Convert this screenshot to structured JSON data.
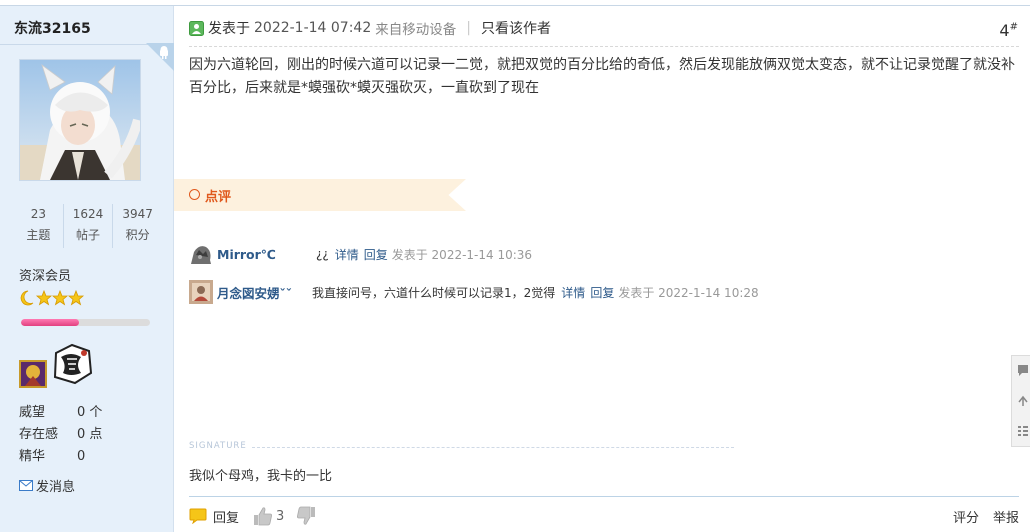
{
  "sidebar": {
    "username": "东流32165",
    "stats": [
      {
        "value": "23",
        "label": "主题"
      },
      {
        "value": "1624",
        "label": "帖子"
      },
      {
        "value": "3947",
        "label": "积分"
      }
    ],
    "group": "资深会员",
    "level_progress_percent": 45,
    "info": [
      {
        "key": "威望",
        "value": "0 个"
      },
      {
        "key": "存在感",
        "value": "0 点"
      },
      {
        "key": "精华",
        "value": "0"
      }
    ],
    "message_label": "发消息"
  },
  "post": {
    "header_label": "发表于",
    "time": "2022-1-14 07:42",
    "source": "来自移动设备",
    "only_author": "只看该作者",
    "floor": "4",
    "floor_suffix": "#",
    "content": "因为六道轮回，刚出的时候六道可以记录一二觉，就把双觉的百分比给的奇低，然后发现能放俩双觉太变态，就不让记录觉醒了就没补百分比，后来就是*蟆强砍*蟆灭强砍灭，一直砍到了现在"
  },
  "comments": {
    "title": "点评",
    "items": [
      {
        "user": "Mirror℃",
        "text": "¿¿",
        "detail": "详情",
        "reply": "回复",
        "date": "发表于 2022-1-14 10:36"
      },
      {
        "user": "月念図安娚ˇˇ",
        "text": "我直接问号，六道什么时候可以记录1，2觉得",
        "detail": "详情",
        "reply": "回复",
        "date": "发表于 2022-1-14 10:28"
      }
    ]
  },
  "signature": {
    "label": "SIGNATURE",
    "text": "我似个母鸡，我卡的一比"
  },
  "footer": {
    "reply": "回复",
    "like_count": "3",
    "rate": "评分",
    "report": "举报"
  },
  "colors": {
    "sidebar_bg": "#e6f0fa",
    "link": "#2e5a8a",
    "comment_accent": "#e0581c",
    "progress": "#e2417f"
  }
}
